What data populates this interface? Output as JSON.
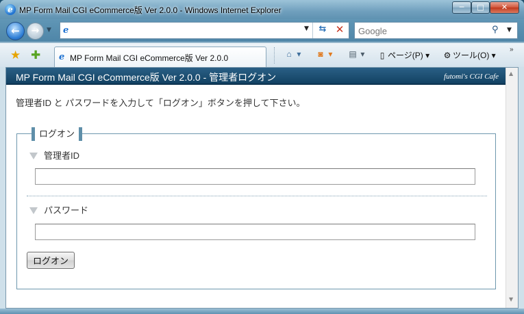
{
  "window": {
    "title": "MP Form Mail CGI eCommerce版 Ver 2.0.0 - Windows Internet Explorer",
    "controls": {
      "minimize": "─",
      "maximize": "□",
      "close": "✕"
    }
  },
  "address_bar": {
    "url": "",
    "search_placeholder": "Google"
  },
  "tabs": [
    {
      "label": "MP Form Mail CGI eCommerce版 Ver 2.0.0",
      "active": true
    }
  ],
  "command_bar": {
    "page_label": "ページ(P)",
    "tools_label": "ツール(O)"
  },
  "page": {
    "header_title": "MP Form Mail CGI eCommerce版 Ver 2.0.0 - 管理者ログオン",
    "header_brand": "futomi's CGI Cafe",
    "instructions": "管理者ID と パスワードを入力して「ログオン」ボタンを押して下さい。",
    "form": {
      "legend": "ログオン",
      "admin_id_label": "管理者ID",
      "admin_id_value": "",
      "password_label": "パスワード",
      "password_value": "",
      "submit_label": "ログオン"
    }
  },
  "icons": {
    "ie": "ie-logo-icon",
    "back": "back-arrow-icon",
    "forward": "forward-arrow-icon",
    "refresh": "refresh-icon",
    "stop": "stop-icon",
    "search": "magnifier-icon",
    "favorites": "favorites-star-icon",
    "add_favorites": "add-favorites-icon",
    "home": "home-icon",
    "feeds": "rss-feed-icon",
    "print": "printer-icon",
    "page": "page-icon",
    "tools": "gear-icon"
  },
  "colors": {
    "header_bg": "#134263",
    "fieldset_border": "#6d97ad",
    "legend_accent": "#5f8fa9"
  }
}
